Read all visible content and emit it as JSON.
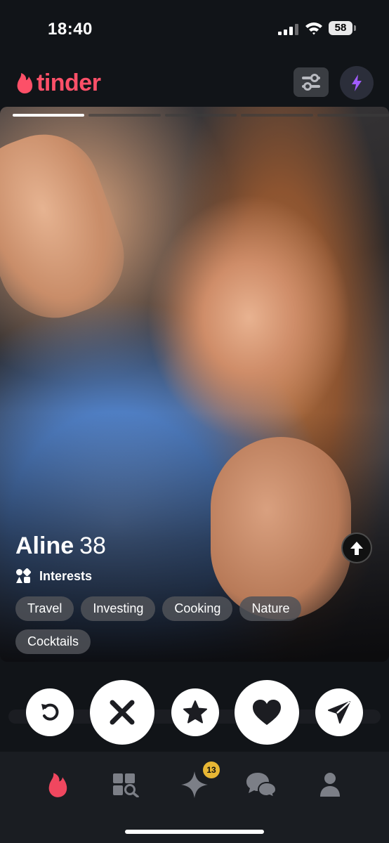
{
  "status_bar": {
    "time": "18:40",
    "battery": "58"
  },
  "header": {
    "logo_text": "tinder"
  },
  "card": {
    "photo_count": 5,
    "active_photo": 1,
    "name": "Aline",
    "age": "38",
    "interests_label": "Interests",
    "interests": [
      "Travel",
      "Investing",
      "Cooking",
      "Nature",
      "Cocktails"
    ]
  },
  "tabbar": {
    "likes_badge": "13"
  },
  "colors": {
    "brand": "#fd5068",
    "super_like": "#3f6fd6",
    "badge": "#e7b634",
    "boost": "#a15cff"
  }
}
